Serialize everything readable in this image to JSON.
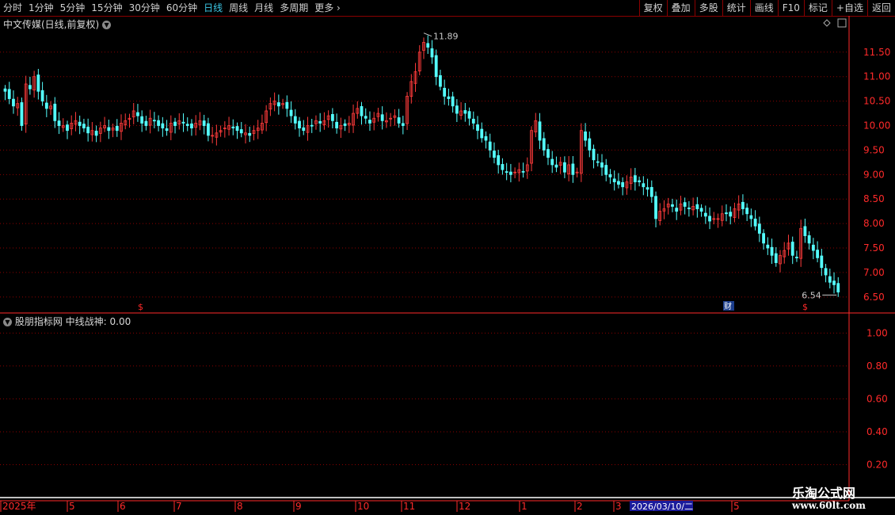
{
  "toolbar": {
    "periods": [
      "分时",
      "1分钟",
      "5分钟",
      "15分钟",
      "30分钟",
      "60分钟",
      "日线",
      "周线",
      "月线",
      "多周期",
      "更多"
    ],
    "active_index": 6,
    "right_buttons": [
      "复权",
      "叠加",
      "多股",
      "统计",
      "画线",
      "F10",
      "标记",
      "+自选",
      "返回"
    ]
  },
  "main_chart": {
    "title": "中文传媒(日线,前复权)",
    "high_label": "11.89",
    "low_label": "6.54",
    "marker_s": "$",
    "marker_cai": "财"
  },
  "indicator": {
    "title": "股朋指标网",
    "name": "中线战神:",
    "value": "0.00"
  },
  "time_axis": {
    "labels": [
      "2025年",
      "5",
      "6",
      "7",
      "8",
      "9",
      "10",
      "11",
      "12",
      "1",
      "2",
      "3",
      "5"
    ],
    "cursor": "2026/03/10/二"
  },
  "watermark": {
    "name": "乐淘公式网",
    "url": "www.60lt.com"
  },
  "colors": {
    "up": "#ff3b3b",
    "down": "#54ffff",
    "grid": "#8b0000",
    "axis": "#ff2a2a",
    "line": "#ffffff"
  },
  "chart_data": [
    {
      "type": "candlestick",
      "title": "中文传媒(日线,前复权)",
      "ylim": [
        6.4,
        11.95
      ],
      "yticks": [
        6.5,
        7.0,
        7.5,
        8.0,
        8.5,
        9.0,
        9.5,
        10.0,
        10.5,
        11.0,
        11.5
      ],
      "close": [
        10.7,
        10.55,
        10.4,
        10.45,
        10.0,
        10.85,
        10.75,
        11.0,
        10.7,
        10.5,
        10.35,
        10.4,
        10.1,
        10.0,
        10.0,
        9.9,
        10.05,
        10.1,
        10.0,
        9.95,
        9.85,
        9.9,
        9.8,
        9.95,
        10.0,
        9.9,
        9.95,
        9.9,
        10.05,
        10.1,
        10.15,
        10.3,
        10.2,
        10.05,
        10.0,
        10.15,
        10.1,
        10.0,
        9.95,
        9.9,
        10.05,
        10.0,
        10.1,
        10.05,
        10.0,
        9.95,
        10.05,
        10.1,
        10.0,
        9.8,
        9.8,
        9.85,
        9.9,
        9.95,
        10.0,
        9.95,
        9.9,
        9.85,
        9.85,
        9.8,
        9.9,
        9.95,
        10.05,
        10.3,
        10.45,
        10.5,
        10.4,
        10.45,
        10.35,
        10.2,
        10.05,
        9.95,
        9.9,
        10.0,
        10.0,
        10.1,
        10.05,
        10.1,
        10.2,
        10.1,
        9.95,
        10.0,
        10.0,
        10.05,
        10.25,
        10.35,
        10.2,
        10.15,
        10.05,
        10.15,
        10.25,
        10.1,
        10.1,
        10.15,
        10.2,
        10.05,
        10.0,
        10.6,
        10.9,
        11.1,
        11.5,
        11.7,
        11.6,
        11.4,
        11.0,
        10.8,
        10.6,
        10.55,
        10.4,
        10.25,
        10.3,
        10.25,
        10.15,
        10.05,
        9.9,
        9.75,
        9.7,
        9.5,
        9.35,
        9.2,
        9.1,
        9.05,
        9.0,
        9.05,
        9.1,
        9.05,
        9.2,
        9.9,
        10.1,
        9.7,
        9.5,
        9.35,
        9.2,
        9.15,
        9.25,
        9.05,
        9.2,
        9.0,
        9.05,
        9.9,
        9.7,
        9.5,
        9.3,
        9.25,
        9.15,
        9.0,
        8.95,
        8.85,
        8.8,
        8.75,
        8.85,
        8.95,
        8.85,
        8.85,
        8.75,
        8.7,
        8.55,
        8.1,
        8.25,
        8.3,
        8.4,
        8.35,
        8.25,
        8.4,
        8.35,
        8.3,
        8.35,
        8.3,
        8.25,
        8.15,
        8.05,
        8.1,
        8.1,
        8.2,
        8.2,
        8.15,
        8.3,
        8.4,
        8.3,
        8.2,
        8.1,
        7.95,
        7.8,
        7.6,
        7.5,
        7.35,
        7.2,
        7.35,
        7.45,
        7.6,
        7.35,
        7.3,
        7.9,
        7.75,
        7.6,
        7.45,
        7.3,
        7.1,
        6.95,
        6.8,
        6.75,
        6.6
      ],
      "high_mark": 11.89,
      "low_mark": 6.54
    },
    {
      "type": "line",
      "name": "中线战神",
      "ylim": [
        0,
        1.05
      ],
      "yticks": [
        0.2,
        0.4,
        0.6,
        0.8,
        1.0
      ],
      "spike_indices": [
        [
          54,
          55
        ],
        [
          84,
          86
        ],
        [
          123,
          125
        ]
      ],
      "x_count": 160
    }
  ]
}
